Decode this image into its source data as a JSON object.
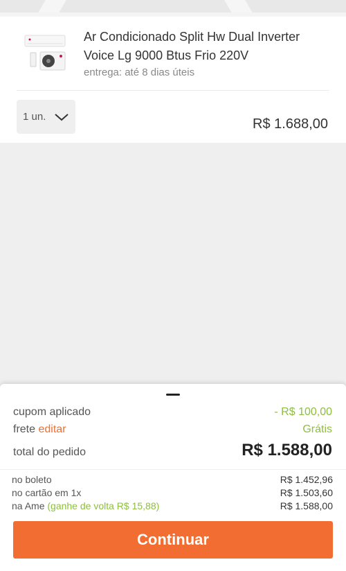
{
  "product": {
    "title": "Ar Condicionado Split Hw Dual Inverter Voice Lg 9000 Btus Frio 220V",
    "delivery": "entrega: até 8 dias úteis",
    "quantity": "1 un.",
    "price": "R$ 1.688,00"
  },
  "summary": {
    "coupon_label": "cupom aplicado",
    "coupon_value": "- R$ 100,00",
    "shipping_label": "frete",
    "shipping_edit": "editar",
    "shipping_value": "Grátis",
    "total_label": "total do pedido",
    "total_value": "R$ 1.588,00"
  },
  "payment_options": [
    {
      "label": "no boleto",
      "extra": "",
      "value": "R$ 1.452,96"
    },
    {
      "label": "no cartão em 1x",
      "extra": "",
      "value": "R$ 1.503,60"
    },
    {
      "label": "na Ame",
      "extra": "(ganhe de volta R$ 15,88)",
      "value": "R$ 1.588,00"
    }
  ],
  "actions": {
    "continue_label": "Continuar"
  },
  "colors": {
    "accent": "#f26d31",
    "green": "#8dbf3d",
    "edit_link": "#f0702f"
  }
}
